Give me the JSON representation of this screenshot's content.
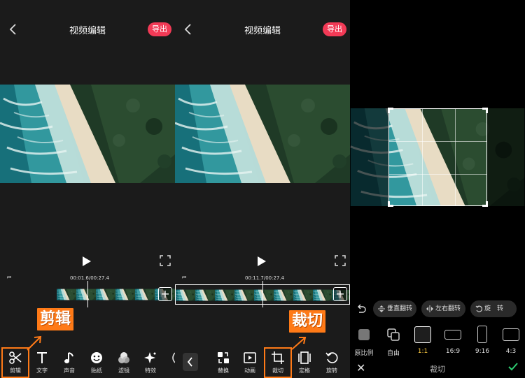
{
  "colors": {
    "accent": "#f23a56",
    "callout": "#ff7a17",
    "selected_ratio": "#f5c53e",
    "confirm": "#2ecc71"
  },
  "panel_left": {
    "title": "视频编辑",
    "export_label": "导出",
    "timecode": "00:01.6/00:27.4",
    "tools": [
      {
        "label": "剪辑",
        "icon": "scissors-icon"
      },
      {
        "label": "文字",
        "icon": "text-icon"
      },
      {
        "label": "声音",
        "icon": "music-note-icon"
      },
      {
        "label": "贴纸",
        "icon": "smiley-icon"
      },
      {
        "label": "滤镜",
        "icon": "filter-icon"
      },
      {
        "label": "特效",
        "icon": "sparkle-icon"
      }
    ],
    "callout": "剪辑"
  },
  "panel_middle": {
    "title": "视频编辑",
    "export_label": "导出",
    "timecode": "00:11.7/00:27.4",
    "tools": [
      {
        "label": "替换",
        "icon": "replace-icon"
      },
      {
        "label": "动画",
        "icon": "animation-icon"
      },
      {
        "label": "裁切",
        "icon": "crop-icon"
      },
      {
        "label": "定格",
        "icon": "freeze-frame-icon"
      },
      {
        "label": "旋转",
        "icon": "rotate-icon"
      }
    ],
    "callout": "裁切"
  },
  "panel_right": {
    "flip_vertical": "垂直翻转",
    "flip_horizontal": "左右翻转",
    "rotate": "旋　转",
    "ratios": [
      {
        "label": "原比例",
        "active": false
      },
      {
        "label": "自由",
        "active": false
      },
      {
        "label": "1:1",
        "active": true
      },
      {
        "label": "16:9",
        "active": false
      },
      {
        "label": "9:16",
        "active": false
      },
      {
        "label": "4:3",
        "active": false
      }
    ],
    "bottom_title": "裁切"
  }
}
